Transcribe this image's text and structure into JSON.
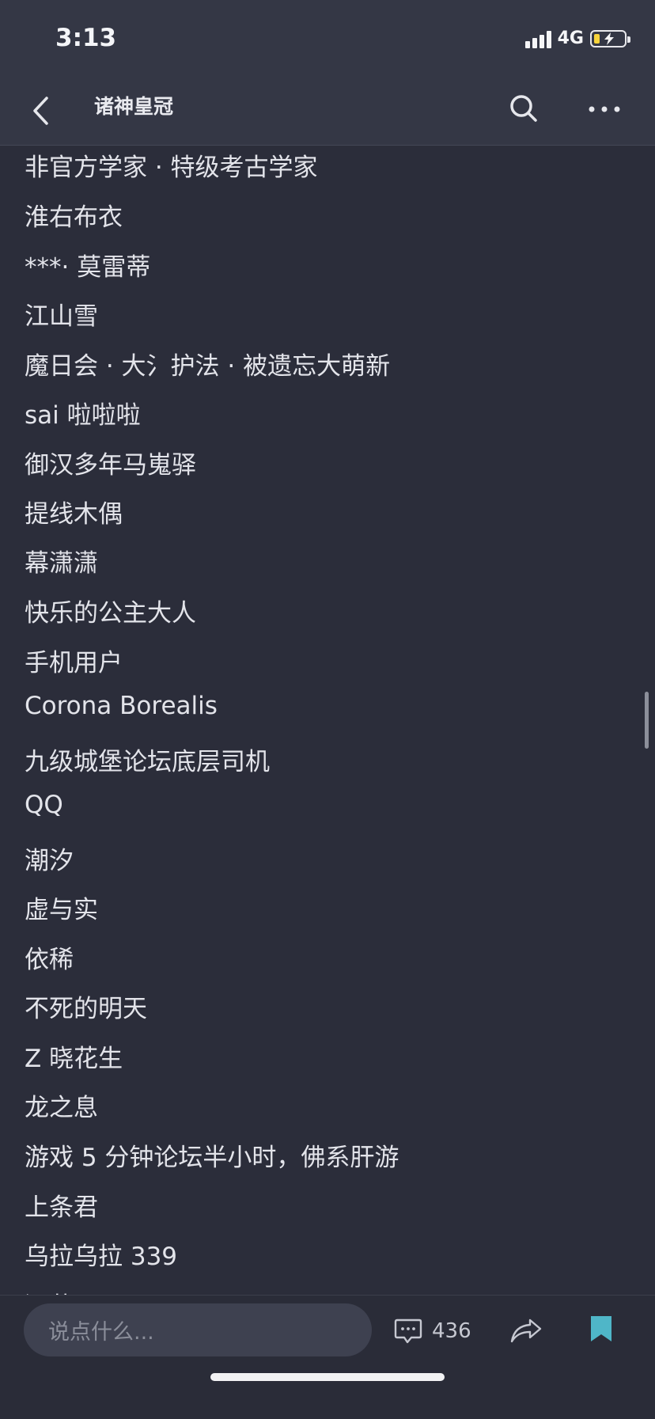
{
  "status_bar": {
    "time": "3:13",
    "network": "4G",
    "battery_level": 0.2,
    "battery_color": "#f7d33b",
    "charging": true
  },
  "nav": {
    "title": "诸神皇冠",
    "back_icon": "chevron-left-icon",
    "search_icon": "search-icon",
    "more_icon": "more-icon"
  },
  "list": {
    "items": [
      "非官方学家 · 特级考古学家",
      "淮右布衣",
      "***· 莫雷蒂",
      "江山雪",
      "魔日会 · 大氵护法 · 被遗忘大萌新",
      "sai 啦啦啦",
      "御汉多年马嵬驿",
      "提线木偶",
      "幕潇潇",
      "快乐的公主大人",
      "手机用户",
      "Corona Borealis",
      "九级城堡论坛底层司机",
      "QQ",
      "潮汐",
      "虚与实",
      "依稀",
      "不死的明天",
      "Z 晓花生",
      "龙之息",
      "游戏 5 分钟论坛半小时，佛系肝游",
      "上条君",
      "乌拉乌拉 339",
      "酒菜"
    ]
  },
  "bottom_bar": {
    "input_placeholder": "说点什么...",
    "comment_count": "436",
    "comment_icon": "comment-icon",
    "share_icon": "share-icon",
    "bookmark_icon": "bookmark-icon",
    "bookmark_color": "#4fb6c8"
  }
}
